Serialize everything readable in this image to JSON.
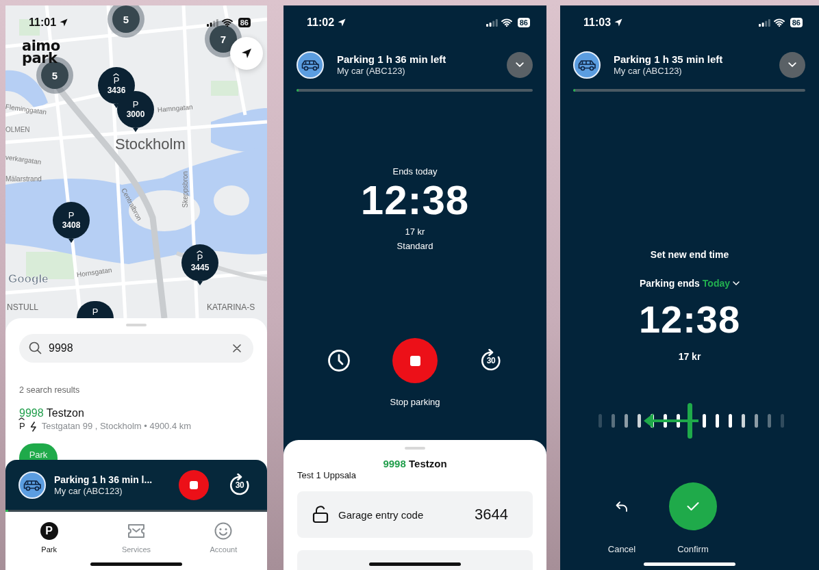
{
  "phones": [
    {
      "kind": "map",
      "status_bar": {
        "time": "11:01",
        "battery": "86"
      },
      "logo": [
        "aimo",
        "park"
      ],
      "map": {
        "labels": [
          "Stockholm",
          "Hamngatan",
          "Fleminggatan",
          "OLMEN",
          "verkargatan",
          "Mälarstrand",
          "Centralbron",
          "Skeppsbron",
          "Hornsgatan",
          "NSTULL",
          "KATARINA-S"
        ],
        "attribution": "Google",
        "clusters": [
          "5",
          "5",
          "7"
        ],
        "pins": [
          {
            "symbol": "P",
            "code": "3436",
            "covered": true
          },
          {
            "symbol": "P",
            "code": "3000",
            "covered": false
          },
          {
            "symbol": "P",
            "code": "3408",
            "covered": false
          },
          {
            "symbol": "P",
            "code": "3445",
            "covered": true
          },
          {
            "symbol": "P",
            "covered": false
          }
        ]
      },
      "search": {
        "value": "9998"
      },
      "results_count": "2 search results",
      "results": [
        {
          "code": "9998",
          "name": "Testzon",
          "symbol": "P",
          "covered": true,
          "address": "Testgatan 99 , Stockholm • 4900.4 km",
          "action": "Park"
        }
      ],
      "active_bar": {
        "title": "Parking 1 h 36 min l...",
        "vehicle": "My car (ABC123)",
        "level": 0.01,
        "extend": "30"
      },
      "nav": [
        {
          "label": "Park",
          "symbol": "P",
          "selected": true
        },
        {
          "label": "Services",
          "selected": false
        },
        {
          "label": "Account",
          "selected": false
        }
      ]
    },
    {
      "kind": "active",
      "status_bar": {
        "time": "11:02",
        "battery": "86"
      },
      "header": {
        "title": "Parking 1 h 36 min left",
        "vehicle": "My car (ABC123)",
        "level": 0.01
      },
      "ends_label": "Ends today",
      "end_time": "12:38",
      "price": "17 kr",
      "tariff": "Standard",
      "extend": "30",
      "stop_label": "Stop parking",
      "zone": {
        "code": "9998",
        "name": "Testzon",
        "location": "Test 1 Uppsala"
      },
      "cards": [
        {
          "kind": "code",
          "label": "Garage entry code",
          "value": "3644"
        },
        {
          "kind": "blank"
        }
      ]
    },
    {
      "kind": "edit",
      "status_bar": {
        "time": "11:03",
        "battery": "86"
      },
      "header": {
        "title": "Parking 1 h 35 min left",
        "vehicle": "My car (ABC123)",
        "level": 0.01
      },
      "heading": "Set new end time",
      "ends": {
        "label": "Parking ends",
        "day": "Today"
      },
      "end_time": "12:38",
      "price": "17 kr",
      "cancel": "Cancel",
      "confirm": "Confirm"
    }
  ]
}
